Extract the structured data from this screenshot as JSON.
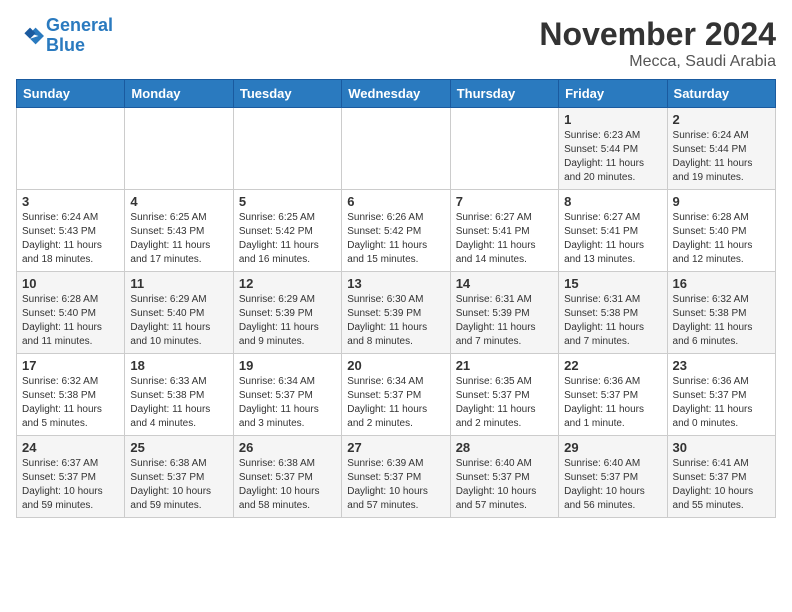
{
  "header": {
    "logo_line1": "General",
    "logo_line2": "Blue",
    "month": "November 2024",
    "location": "Mecca, Saudi Arabia"
  },
  "weekdays": [
    "Sunday",
    "Monday",
    "Tuesday",
    "Wednesday",
    "Thursday",
    "Friday",
    "Saturday"
  ],
  "weeks": [
    [
      {
        "day": "",
        "info": ""
      },
      {
        "day": "",
        "info": ""
      },
      {
        "day": "",
        "info": ""
      },
      {
        "day": "",
        "info": ""
      },
      {
        "day": "",
        "info": ""
      },
      {
        "day": "1",
        "info": "Sunrise: 6:23 AM\nSunset: 5:44 PM\nDaylight: 11 hours\nand 20 minutes."
      },
      {
        "day": "2",
        "info": "Sunrise: 6:24 AM\nSunset: 5:44 PM\nDaylight: 11 hours\nand 19 minutes."
      }
    ],
    [
      {
        "day": "3",
        "info": "Sunrise: 6:24 AM\nSunset: 5:43 PM\nDaylight: 11 hours\nand 18 minutes."
      },
      {
        "day": "4",
        "info": "Sunrise: 6:25 AM\nSunset: 5:43 PM\nDaylight: 11 hours\nand 17 minutes."
      },
      {
        "day": "5",
        "info": "Sunrise: 6:25 AM\nSunset: 5:42 PM\nDaylight: 11 hours\nand 16 minutes."
      },
      {
        "day": "6",
        "info": "Sunrise: 6:26 AM\nSunset: 5:42 PM\nDaylight: 11 hours\nand 15 minutes."
      },
      {
        "day": "7",
        "info": "Sunrise: 6:27 AM\nSunset: 5:41 PM\nDaylight: 11 hours\nand 14 minutes."
      },
      {
        "day": "8",
        "info": "Sunrise: 6:27 AM\nSunset: 5:41 PM\nDaylight: 11 hours\nand 13 minutes."
      },
      {
        "day": "9",
        "info": "Sunrise: 6:28 AM\nSunset: 5:40 PM\nDaylight: 11 hours\nand 12 minutes."
      }
    ],
    [
      {
        "day": "10",
        "info": "Sunrise: 6:28 AM\nSunset: 5:40 PM\nDaylight: 11 hours\nand 11 minutes."
      },
      {
        "day": "11",
        "info": "Sunrise: 6:29 AM\nSunset: 5:40 PM\nDaylight: 11 hours\nand 10 minutes."
      },
      {
        "day": "12",
        "info": "Sunrise: 6:29 AM\nSunset: 5:39 PM\nDaylight: 11 hours\nand 9 minutes."
      },
      {
        "day": "13",
        "info": "Sunrise: 6:30 AM\nSunset: 5:39 PM\nDaylight: 11 hours\nand 8 minutes."
      },
      {
        "day": "14",
        "info": "Sunrise: 6:31 AM\nSunset: 5:39 PM\nDaylight: 11 hours\nand 7 minutes."
      },
      {
        "day": "15",
        "info": "Sunrise: 6:31 AM\nSunset: 5:38 PM\nDaylight: 11 hours\nand 7 minutes."
      },
      {
        "day": "16",
        "info": "Sunrise: 6:32 AM\nSunset: 5:38 PM\nDaylight: 11 hours\nand 6 minutes."
      }
    ],
    [
      {
        "day": "17",
        "info": "Sunrise: 6:32 AM\nSunset: 5:38 PM\nDaylight: 11 hours\nand 5 minutes."
      },
      {
        "day": "18",
        "info": "Sunrise: 6:33 AM\nSunset: 5:38 PM\nDaylight: 11 hours\nand 4 minutes."
      },
      {
        "day": "19",
        "info": "Sunrise: 6:34 AM\nSunset: 5:37 PM\nDaylight: 11 hours\nand 3 minutes."
      },
      {
        "day": "20",
        "info": "Sunrise: 6:34 AM\nSunset: 5:37 PM\nDaylight: 11 hours\nand 2 minutes."
      },
      {
        "day": "21",
        "info": "Sunrise: 6:35 AM\nSunset: 5:37 PM\nDaylight: 11 hours\nand 2 minutes."
      },
      {
        "day": "22",
        "info": "Sunrise: 6:36 AM\nSunset: 5:37 PM\nDaylight: 11 hours\nand 1 minute."
      },
      {
        "day": "23",
        "info": "Sunrise: 6:36 AM\nSunset: 5:37 PM\nDaylight: 11 hours\nand 0 minutes."
      }
    ],
    [
      {
        "day": "24",
        "info": "Sunrise: 6:37 AM\nSunset: 5:37 PM\nDaylight: 10 hours\nand 59 minutes."
      },
      {
        "day": "25",
        "info": "Sunrise: 6:38 AM\nSunset: 5:37 PM\nDaylight: 10 hours\nand 59 minutes."
      },
      {
        "day": "26",
        "info": "Sunrise: 6:38 AM\nSunset: 5:37 PM\nDaylight: 10 hours\nand 58 minutes."
      },
      {
        "day": "27",
        "info": "Sunrise: 6:39 AM\nSunset: 5:37 PM\nDaylight: 10 hours\nand 57 minutes."
      },
      {
        "day": "28",
        "info": "Sunrise: 6:40 AM\nSunset: 5:37 PM\nDaylight: 10 hours\nand 57 minutes."
      },
      {
        "day": "29",
        "info": "Sunrise: 6:40 AM\nSunset: 5:37 PM\nDaylight: 10 hours\nand 56 minutes."
      },
      {
        "day": "30",
        "info": "Sunrise: 6:41 AM\nSunset: 5:37 PM\nDaylight: 10 hours\nand 55 minutes."
      }
    ]
  ]
}
